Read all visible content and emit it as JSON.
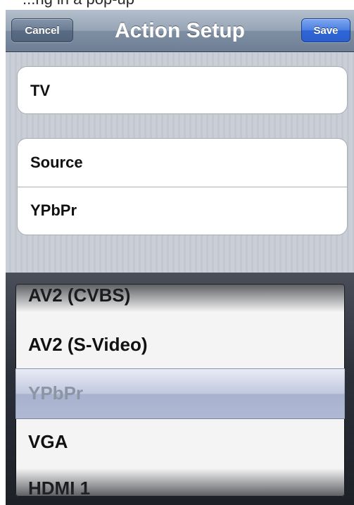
{
  "top_caption": "...ng in a pop-up",
  "navbar": {
    "cancel_label": "Cancel",
    "title": "Action Setup",
    "save_label": "Save"
  },
  "form": {
    "device": "TV",
    "action_label": "Source",
    "action_value": "YPbPr"
  },
  "picker": {
    "options": [
      "AV2 (CVBS)",
      "AV2 (S-Video)",
      "YPbPr",
      "VGA",
      "HDMI 1"
    ],
    "selected": "YPbPr"
  }
}
